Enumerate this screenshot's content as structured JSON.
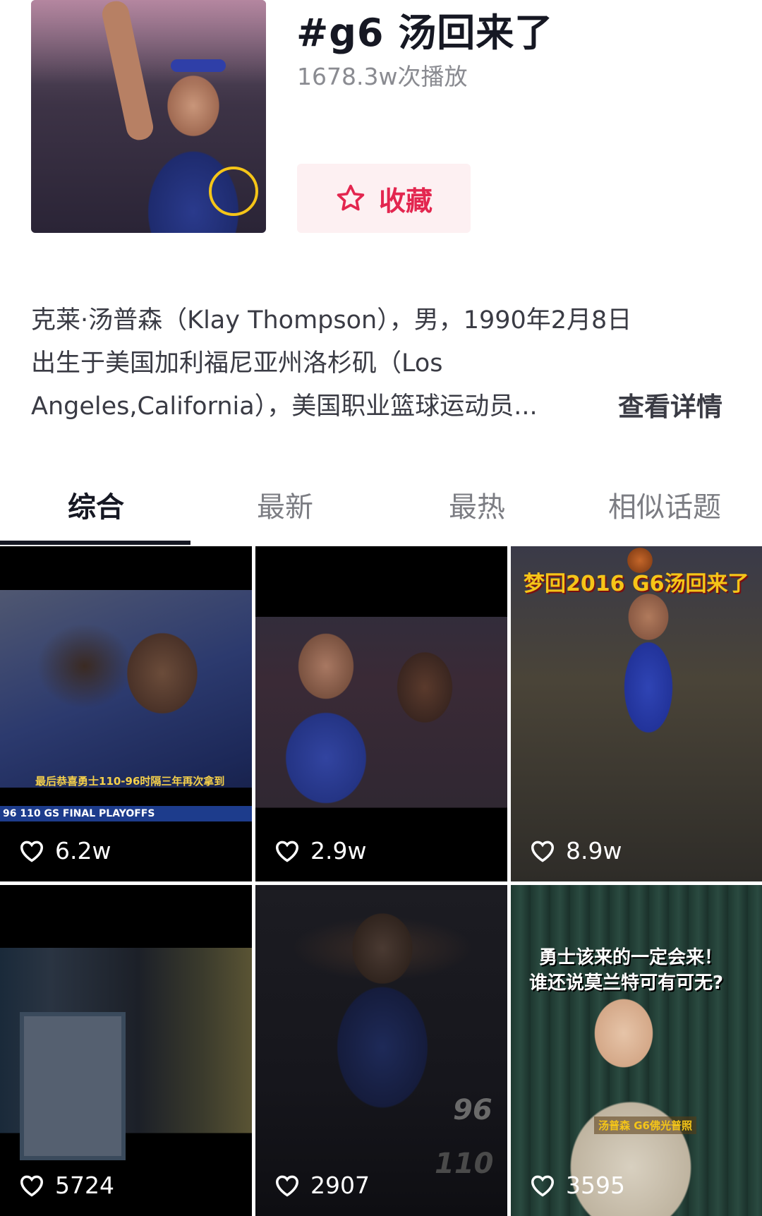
{
  "header": {
    "title": "#g6 汤回来了",
    "plays": "1678.3w次播放",
    "favorite_label": "收藏"
  },
  "description": {
    "lines": [
      "克莱·汤普森（Klay Thompson），男，1990年2月8日",
      "出生于美国加利福尼亚州洛杉矶（Los",
      "Angeles,California），美国职业篮球运动员..."
    ],
    "more_label": "查看详情"
  },
  "tabs": [
    {
      "label": "综合",
      "active": true
    },
    {
      "label": "最新",
      "active": false
    },
    {
      "label": "最热",
      "active": false
    },
    {
      "label": "相似话题",
      "active": false
    }
  ],
  "videos": [
    {
      "likes": "6.2w",
      "caption": "最后恭喜勇士110-96时隔三年再次拿到",
      "scoreboard": "96  110  GS  FINAL  PLAYOFFS"
    },
    {
      "likes": "2.9w",
      "caption": ""
    },
    {
      "likes": "8.9w",
      "caption": "梦回2016 G6汤回来了"
    },
    {
      "likes": "5724",
      "caption": ""
    },
    {
      "likes": "2907",
      "caption": "",
      "scores": [
        "96",
        "110"
      ]
    },
    {
      "likes": "3595",
      "caption_lines": [
        "勇士该来的一定会来！",
        "谁还说莫兰特可有可无?"
      ],
      "subcaption": "汤普森 G6佛光普照"
    }
  ],
  "colors": {
    "accent": "#e3264f",
    "favorite_bg": "#fdf0f2",
    "text_primary": "#161823",
    "text_secondary": "#8a8b91"
  }
}
